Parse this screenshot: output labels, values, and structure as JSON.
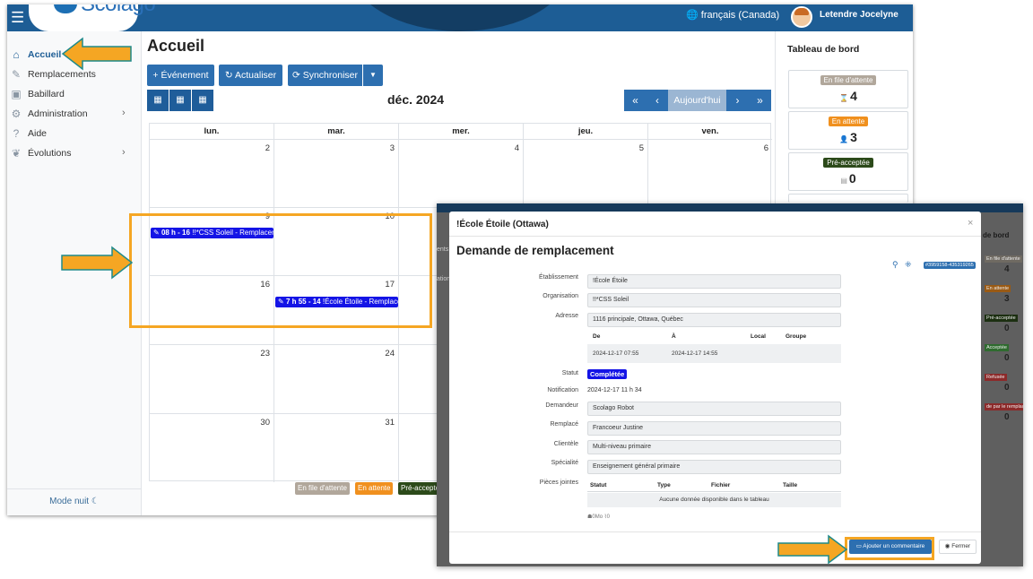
{
  "header": {
    "brand": "Scolago",
    "language": "français (Canada)",
    "user_name": "Letendre Jocelyne"
  },
  "sidebar": {
    "items": [
      {
        "label": "Accueil",
        "icon": "home-icon",
        "active": true
      },
      {
        "label": "Remplacements",
        "icon": "replacement-icon"
      },
      {
        "label": "Babillard",
        "icon": "board-icon"
      },
      {
        "label": "Administration",
        "icon": "gear-icon",
        "has_children": true
      },
      {
        "label": "Aide",
        "icon": "help-icon"
      },
      {
        "label": "Évolutions",
        "icon": "sprout-icon",
        "has_children": true
      }
    ],
    "night_mode": "Mode nuit"
  },
  "main": {
    "title": "Accueil",
    "toolbar": {
      "event_label": "Événement",
      "refresh_label": "Actualiser",
      "sync_label": "Synchroniser"
    },
    "calendar": {
      "month_label": "déc. 2024",
      "today_label": "Aujourd'hui",
      "weekdays": [
        "lun.",
        "mar.",
        "mer.",
        "jeu.",
        "ven."
      ],
      "weeks": [
        [
          "2",
          "3",
          "4",
          "5",
          "6"
        ],
        [
          "9",
          "10",
          "",
          "",
          ""
        ],
        [
          "16",
          "17",
          "",
          "",
          ""
        ],
        [
          "23",
          "24",
          "",
          "",
          ""
        ],
        [
          "30",
          "31",
          "",
          "",
          ""
        ]
      ],
      "events": [
        {
          "time": "08 h - 16",
          "text": "!!*CSS Soleil - Remplacem"
        },
        {
          "time": "7 h 55 - 14",
          "text": "!École Étoile - Remplace"
        }
      ]
    },
    "legend": [
      "En file d'attente",
      "En attente",
      "Pré-accepté"
    ]
  },
  "dashboard": {
    "title": "Tableau de bord",
    "cards": [
      {
        "label": "En file d'attente",
        "count": "4",
        "color": "#b1a79b"
      },
      {
        "label": "En attente",
        "count": "3",
        "color": "#f0901e"
      },
      {
        "label": "Pré-acceptée",
        "count": "0",
        "color": "#2c4a1a"
      }
    ]
  },
  "background_window": {
    "dash_title": "de bord",
    "side_fragments": [
      "ents",
      "ation"
    ],
    "cards": [
      {
        "label": "En file d'attente",
        "count": "4",
        "color": "#6f6a62"
      },
      {
        "label": "En attente",
        "count": "3",
        "color": "#9a5a14"
      },
      {
        "label": "Pré-acceptée",
        "count": "0",
        "color": "#1c2f11"
      },
      {
        "label": "Acceptée",
        "count": "0",
        "color": "#2f6b2f"
      },
      {
        "label": "Refusée",
        "count": "0",
        "color": "#8c2a2a"
      },
      {
        "label": "de par le remplaç",
        "count": "0",
        "color": "#8c2a2a"
      }
    ]
  },
  "modal": {
    "header_title": "!École Étoile (Ottawa)",
    "title": "Demande de remplacement",
    "reference": "#3959158-435319265",
    "fields": [
      {
        "label": "Établissement",
        "value": "!École Étoile"
      },
      {
        "label": "Organisation",
        "value": "!!*CSS Soleil"
      },
      {
        "label": "Adresse",
        "value": "1116 principale, Ottawa, Québec"
      }
    ],
    "period_headers": [
      "De",
      "À",
      "Local",
      "Groupe"
    ],
    "period_values": {
      "from": "2024-12-17 07:55",
      "to": "2024-12-17 14:55"
    },
    "status_label": "Statut",
    "status_value": "Complétée",
    "notification_label": "Notification",
    "notification_value": "2024-12-17 11 h 34",
    "details": [
      {
        "label": "Demandeur",
        "value": "Scolago Robot"
      },
      {
        "label": "Remplacé",
        "value": "Francoeur Justine"
      },
      {
        "label": "Clientèle",
        "value": "Multi-niveau primaire"
      },
      {
        "label": "Spécialité",
        "value": "Enseignement général primaire"
      }
    ],
    "attachments_label": "Pièces jointes",
    "attachments_headers": [
      "Statut",
      "Type",
      "Fichier",
      "Taille"
    ],
    "attachments_empty": "Aucune donnée disponible dans le tableau",
    "attachments_footer": "0Mo",
    "attachments_count": "0",
    "comment_button": "Ajouter un commentaire",
    "close_button": "Fermer"
  },
  "colors": {
    "header_blue": "#1d5d95",
    "button_blue": "#2d6fb0",
    "event_blue": "#1414e6",
    "annotation_orange": "#f5a623"
  }
}
